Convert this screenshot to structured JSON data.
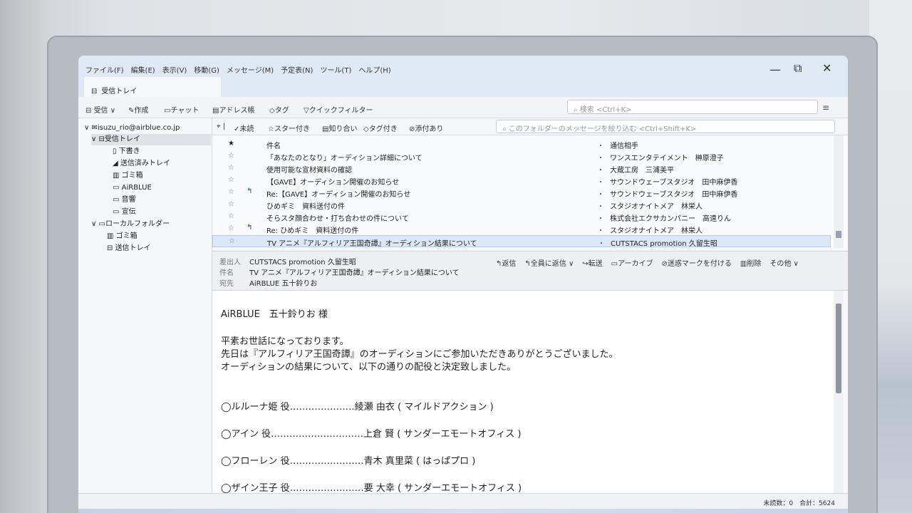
{
  "menu": {
    "items": [
      "ファイル(F)",
      "編集(E)",
      "表示(V)",
      "移動(G)",
      "メッセージ(M)",
      "予定表(N)",
      "ツール(T)",
      "ヘルプ(H)"
    ],
    "restore_glyph": "⧉",
    "close_glyph": "✕"
  },
  "tab": {
    "label": "受信トレイ"
  },
  "toolbar": {
    "receive": "受信",
    "compose": "作成",
    "chat": "チャット",
    "address_book": "アドレス帳",
    "tag": "タグ",
    "quick_filter": "クイックフィルター",
    "search_placeholder": "検索 <Ctrl+K>"
  },
  "folders": {
    "account": "isuzu_rio@airblue.co.jp",
    "inbox": "受信トレイ",
    "drafts": "下書き",
    "sent": "送信済みトレイ",
    "trash": "ゴミ箱",
    "airblue": "AiRBLUE",
    "sound": "音響",
    "promo": "宣伝",
    "local": "ローカルフォルダー",
    "local_trash": "ゴミ箱",
    "outbox": "送信トレイ"
  },
  "filterbar": {
    "unread": "未読",
    "starred": "スター付き",
    "contacts": "知り合い",
    "tagged": "タグ付き",
    "attachment": "添付あり",
    "placeholder": "このフォルダーのメッセージを絞り込む <Ctrl+Shift+K>"
  },
  "messages": {
    "col_subject": "件名",
    "col_correspondent": "通信相手",
    "rows": [
      {
        "subject": "「あなたのとなり」オーディション詳細について",
        "sender": "ワンスエンタテイメント　榊原澄子",
        "replied": false,
        "selected": false
      },
      {
        "subject": "使用可能な宣材資料の確認",
        "sender": "大蔵工房　三浦美平",
        "replied": false,
        "selected": false
      },
      {
        "subject": "【GAVE】オーディション開催のお知らせ",
        "sender": "サウンドウェーブスタジオ　田中麻伊香",
        "replied": false,
        "selected": false
      },
      {
        "subject": "Re:【GAVE】オーディション開催のお知らせ",
        "sender": "サウンドウェーブスタジオ　田中麻伊香",
        "replied": true,
        "selected": false
      },
      {
        "subject": "ひめギミ　資料送付の件",
        "sender": "スタジオナイトメア　林栄人",
        "replied": false,
        "selected": false
      },
      {
        "subject": "そらスタ顔合わせ・打ち合わせの件について",
        "sender": "株式会社エクサカンパニー　高遠りん",
        "replied": false,
        "selected": false
      },
      {
        "subject": "Re: ひめギミ　資料送付の件",
        "sender": "スタジオナイトメア　林栄人",
        "replied": true,
        "selected": false
      },
      {
        "subject": "TV アニメ『アルフィリア王国奇譚』オーディション結果について",
        "sender": "CUTSTACS promotion 久留生昭",
        "replied": false,
        "selected": true
      }
    ]
  },
  "header": {
    "from_label": "差出人",
    "from": "CUTSTACS promotion 久留生昭",
    "subject_label": "件名",
    "subject": "TV アニメ『アルフィリア王国奇譚』オーディション結果について",
    "to_label": "宛先",
    "to": "AiRBLUE 五十鈴りお",
    "reply": "返信",
    "reply_all": "全員に返信",
    "forward": "転送",
    "archive": "アーカイブ",
    "junk": "迷惑マークを付ける",
    "delete": "削除",
    "other": "その他"
  },
  "body": {
    "greeting": "AiRBLUE　五十鈴りお 様",
    "line1": "平素お世話になっております。",
    "line2": "先日は『アルフィリア王国奇譚』のオーディションにご参加いただきありがとうございました。",
    "line3": "オーディションの結果について、以下の通りの配役と決定致しました。",
    "cast": [
      "◯ルルーナ姫 役…………………綾瀬 由衣 ( マイルドアクション )",
      "◯アイン 役…………………………上倉 賢 ( サンダーエモートオフィス )",
      "◯フローレン 役……………………青木 真里菜 ( はっぱプロ )",
      "◯ザイン王子 役……………………要 大幸 ( サンダーエモートオフィス )"
    ]
  },
  "status": {
    "text": "未読数：0　合計：5624"
  }
}
